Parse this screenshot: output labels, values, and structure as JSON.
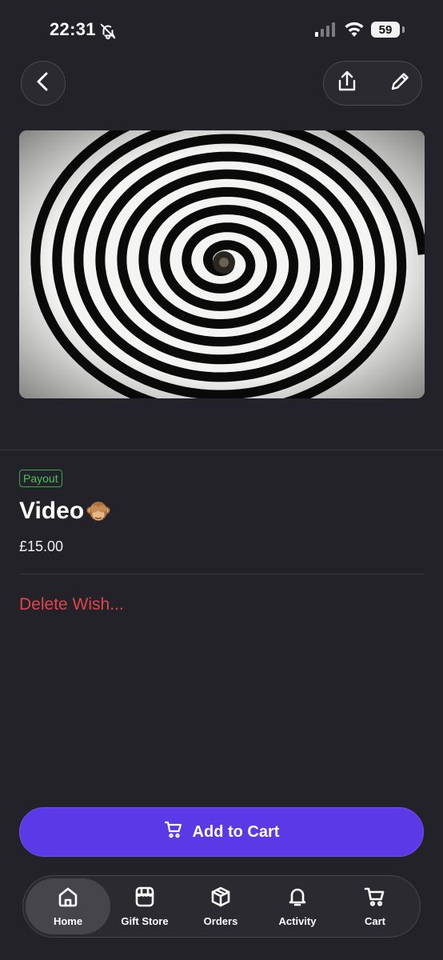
{
  "status_bar": {
    "time": "22:31",
    "battery": "59",
    "icons": [
      "bell-off-icon",
      "signal-icon",
      "wifi-icon",
      "battery-icon"
    ]
  },
  "header": {
    "back_icon": "chevron-left-icon",
    "share_icon": "share-icon",
    "edit_icon": "pencil-icon"
  },
  "wish": {
    "badge": "Payout",
    "title": "Video",
    "title_emoji": "see-no-evil-monkey-icon",
    "price": "£15.00",
    "delete_label": "Delete Wish..."
  },
  "cta": {
    "label": "Add to Cart",
    "icon": "cart-icon"
  },
  "tabs": [
    {
      "label": "Home",
      "icon": "home-icon",
      "active": true
    },
    {
      "label": "Gift Store",
      "icon": "store-icon",
      "active": false
    },
    {
      "label": "Orders",
      "icon": "box-icon",
      "active": false
    },
    {
      "label": "Activity",
      "icon": "bell-icon",
      "active": false
    },
    {
      "label": "Cart",
      "icon": "cart-icon",
      "active": false
    }
  ],
  "colors": {
    "background": "#232228",
    "accent": "#5a39e6",
    "badge_green": "#4cc05e",
    "danger": "#e0454c"
  }
}
